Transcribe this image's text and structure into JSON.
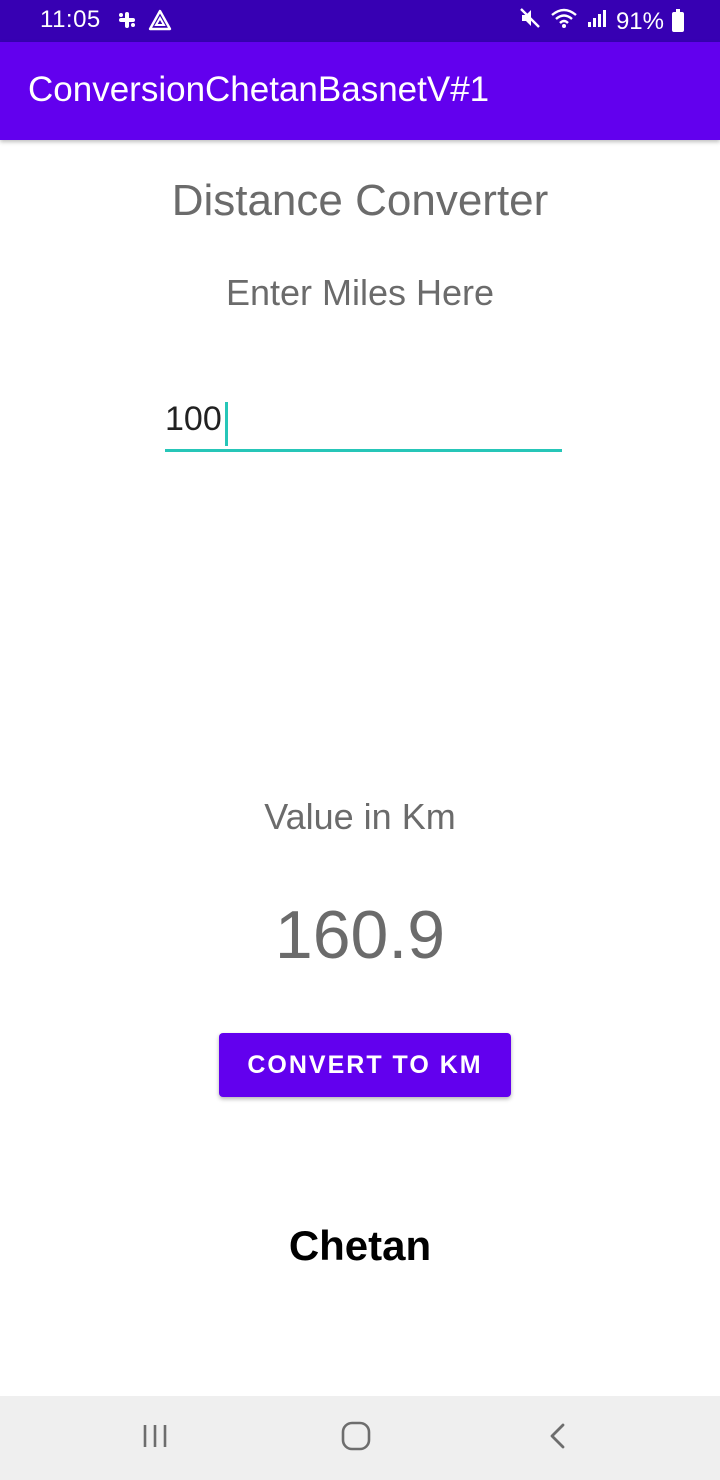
{
  "status_bar": {
    "time": "11:05",
    "battery": "91%",
    "icons": [
      "slack-icon",
      "vpn-triangle-icon",
      "mute-icon",
      "wifi-icon",
      "signal-icon",
      "battery-icon"
    ]
  },
  "app_bar": {
    "title": "ConversionChetanBasnetV#1"
  },
  "main": {
    "heading": "Distance Converter",
    "prompt": "Enter Miles Here",
    "miles_input_value": "100",
    "result_label": "Value in Km",
    "result_value": "160.9",
    "convert_button_label": "CONVERT TO KM",
    "author": "Chetan"
  },
  "nav_bar": {
    "buttons": [
      "recent-apps-icon",
      "home-icon",
      "back-icon"
    ]
  },
  "colors": {
    "status_bar": "#3700b3",
    "primary": "#6200ee",
    "accent": "#26c6b8",
    "text_secondary": "#6b6b6b",
    "nav_bar": "#efefef"
  }
}
